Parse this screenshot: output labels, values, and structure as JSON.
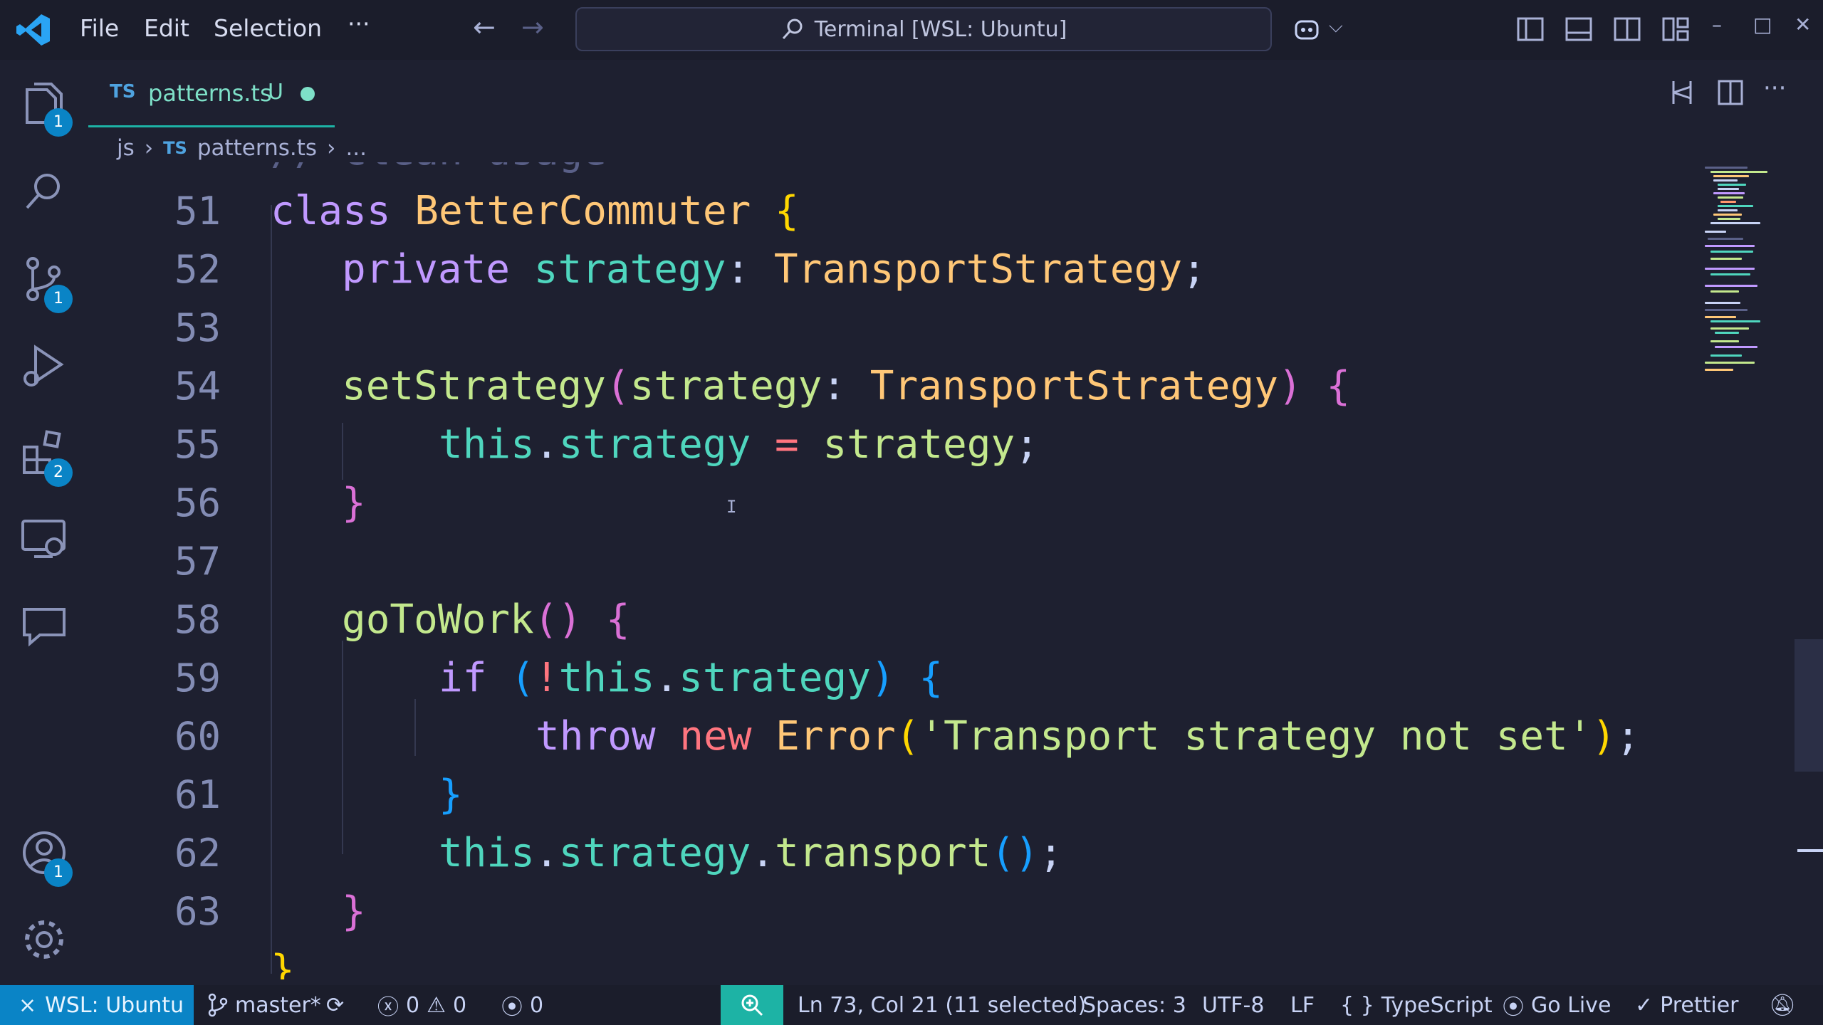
{
  "titlebar": {
    "menu": [
      "File",
      "Edit",
      "Selection",
      "···"
    ],
    "command_center": "Terminal [WSL: Ubuntu]",
    "window_controls": [
      "–",
      "□",
      "✕"
    ]
  },
  "activity_bar": {
    "explorer_badge": "1",
    "source_control_badge": "1",
    "extensions_badge": "2",
    "accounts_badge": "1"
  },
  "tab": {
    "lang": "TS",
    "filename": "patterns.ts",
    "status": "U"
  },
  "breadcrumb": {
    "folder": "js",
    "lang": "TS",
    "file": "patterns.ts",
    "more": "..."
  },
  "editor": {
    "lines": [
      {
        "n": "51"
      },
      {
        "n": "52"
      },
      {
        "n": "53"
      },
      {
        "n": "54"
      },
      {
        "n": "55"
      },
      {
        "n": "56"
      },
      {
        "n": "57"
      },
      {
        "n": "58"
      },
      {
        "n": "59"
      },
      {
        "n": "60"
      },
      {
        "n": "61"
      },
      {
        "n": "62"
      },
      {
        "n": "63"
      }
    ],
    "code": {
      "l50": "// Clean usage",
      "l51": [
        "class",
        " ",
        "BetterCommuter",
        " ",
        "{"
      ],
      "l52": [
        "private",
        " ",
        "strategy",
        ": ",
        "TransportStrategy",
        ";"
      ],
      "l54": [
        "setStrategy",
        "(",
        "strategy",
        ": ",
        "TransportStrategy",
        ")",
        " ",
        "{"
      ],
      "l55": [
        "this",
        ".",
        "strategy",
        " ",
        "=",
        " ",
        "strategy",
        ";"
      ],
      "l56": [
        "}"
      ],
      "l58": [
        "goToWork",
        "()",
        " ",
        "{"
      ],
      "l59": [
        "if",
        " ",
        "(",
        "!",
        "this",
        ".",
        "strategy",
        ")",
        " ",
        "{"
      ],
      "l60": [
        "throw",
        " ",
        "new",
        " ",
        "Error",
        "(",
        "'Transport strategy not set'",
        ")",
        ";"
      ],
      "l61": [
        "}"
      ],
      "l62": [
        "this",
        ".",
        "strategy",
        ".",
        "transport",
        "()",
        ";"
      ],
      "l63": [
        "}"
      ],
      "l64": "}"
    }
  },
  "statusbar": {
    "remote": "WSL: Ubuntu",
    "branch": "master*",
    "errors": "0",
    "warnings": "0",
    "ports": "0",
    "cursor": "Ln 73, Col 21 (11 selected)",
    "spaces": "Spaces: 3",
    "encoding": "UTF-8",
    "eol": "LF",
    "language": "TypeScript",
    "golive": "Go Live",
    "prettier": "Prettier"
  },
  "colors": {
    "accent": "#1db3a5",
    "remote_bg": "#0a84c6",
    "editor_bg": "#1e2030"
  }
}
